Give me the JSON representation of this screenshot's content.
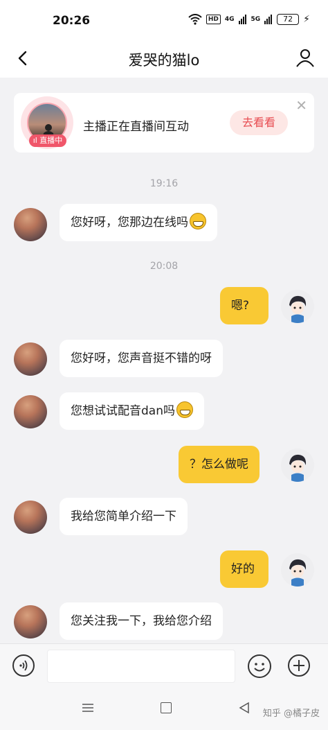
{
  "status_bar": {
    "time": "20:26",
    "network_a": "4G",
    "network_b": "5G",
    "hd": "HD",
    "battery": "72"
  },
  "header": {
    "title": "爱哭的猫lo"
  },
  "live_card": {
    "badge": "直播中",
    "text": "主播正在直播间互动",
    "button": "去看看"
  },
  "messages": [
    {
      "type": "time",
      "text": "19:16"
    },
    {
      "side": "left",
      "text": "您好呀，您那边在线吗",
      "emoji": true
    },
    {
      "type": "time",
      "text": "20:08"
    },
    {
      "side": "right",
      "text": "嗯?"
    },
    {
      "side": "left",
      "text": "您好呀，您声音挺不错的呀"
    },
    {
      "side": "left",
      "text": "您想试试配音dan吗",
      "emoji": true
    },
    {
      "side": "right",
      "text": "？怎么做呢"
    },
    {
      "side": "left",
      "text": "我给您简单介绍一下"
    },
    {
      "side": "right",
      "text": "好的"
    },
    {
      "side": "left",
      "text": "您关注我一下，我给您介绍"
    }
  ],
  "input": {
    "placeholder": ""
  },
  "watermark": "知乎 @橘子皮",
  "icons": [
    "back-arrow-icon",
    "profile-icon",
    "close-icon",
    "voice-icon",
    "emoji-icon",
    "plus-icon",
    "nav-menu-icon",
    "nav-home-icon",
    "nav-back-icon"
  ],
  "colors": {
    "bubble_right": "#f9c934",
    "live_badge": "#f0566a",
    "go_button_text": "#e84d52"
  }
}
